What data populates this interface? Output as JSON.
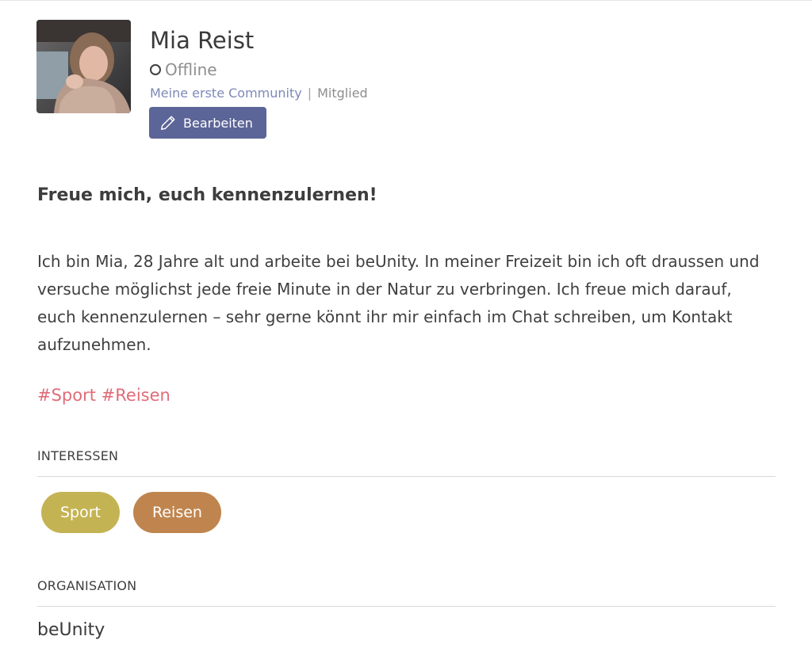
{
  "profile": {
    "name": "Mia Reist",
    "status": "Offline",
    "community": "Meine erste Community",
    "separator": "|",
    "role": "Mitglied",
    "edit_label": "Bearbeiten"
  },
  "about": {
    "headline": "Freue mich, euch kennenzulernen!",
    "bio": "Ich bin Mia, 28 Jahre alt und arbeite bei beUnity. In meiner Freizeit bin ich oft draussen und versuche möglichst jede freie Minute in der Natur zu verbringen. Ich freue mich darauf, euch kennenzulernen – sehr gerne könnt ihr mir einfach im Chat schreiben, um Kontakt aufzunehmen.",
    "hashtags": [
      "#Sport",
      "#Reisen"
    ]
  },
  "interests": {
    "label": "INTERESSEN",
    "items": [
      {
        "label": "Sport",
        "color": "#c4b352"
      },
      {
        "label": "Reisen",
        "color": "#c0854e"
      }
    ]
  },
  "organisation": {
    "label": "ORGANISATION",
    "value": "beUnity"
  },
  "colors": {
    "accent": "#5c6597",
    "link": "#7d89b8",
    "hashtag": "#e06c78"
  },
  "icons": {
    "status": "status-ring-icon",
    "edit": "pencil-icon"
  }
}
